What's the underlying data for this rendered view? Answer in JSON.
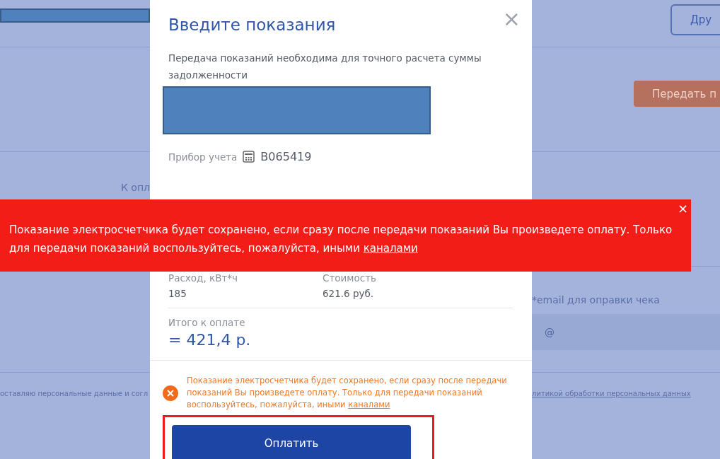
{
  "background_page": {
    "left": {
      "amount_label": "К опл",
      "consent_text": "оставляю персональные данные и согл"
    },
    "right": {
      "other_button": "Дру",
      "submit_button": "Передать п",
      "email_label": "*email для оправки чека",
      "email_field": {
        "placeholder": "@"
      },
      "policy_link": "литикой обработки персональных данных"
    }
  },
  "dialog": {
    "title": "Введите показания",
    "description": "Передача показаний необходима для точного расчета суммы задолженности",
    "meter": {
      "label": "Прибор учета",
      "number": "B065419"
    },
    "readings": [
      {
        "label": "Расход, кВт*ч",
        "value": "185"
      },
      {
        "label": "Стоимость",
        "value": "621.6 руб."
      }
    ],
    "total": {
      "label": "Итого к оплате",
      "amount": "= 421,4 р."
    },
    "warning": {
      "text": "Показание электросчетчика будет сохранено, если сразу после передачи показаний Вы произведете оплату. Только для передачи показаний воспользуйтесь, пожалуйста, иными",
      "link": "каналами"
    },
    "pay_button": {
      "label": "Оплатить",
      "highlighted": true
    },
    "close": "×"
  },
  "banner": {
    "text": "Показание электросчетчика будет сохранено, если сразу после передачи показаний Вы произведете оплату. Только для передачи показаний воспользуйтесь, пожалуйста, иными",
    "link": "каналами",
    "close": "×"
  }
}
